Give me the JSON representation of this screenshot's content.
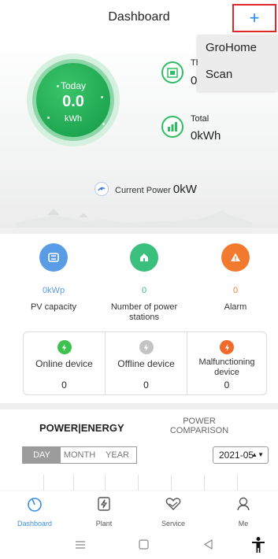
{
  "header": {
    "title": "Dashboard",
    "add_label": "+"
  },
  "dropdown_menu": {
    "items": [
      "GroHome",
      "Scan"
    ]
  },
  "energy": {
    "today_label": "Today",
    "today_value": "0.0",
    "today_unit": "kWh",
    "this_label_partial": "Th",
    "this_value_partial": "0",
    "total_label": "Total",
    "total_value": "0kWh",
    "current_power_label": "Current Power",
    "current_power_value": "0kW"
  },
  "metrics": [
    {
      "value": "0kWp",
      "label": "PV capacity",
      "color": "#5a9be6",
      "icon": "pv-panel-icon"
    },
    {
      "value": "0",
      "label": "Number of power stations",
      "color": "#3bbf7c",
      "icon": "home-icon"
    },
    {
      "value": "0",
      "label": "Alarm",
      "color": "#f27a2f",
      "icon": "warning-icon"
    }
  ],
  "devices": [
    {
      "label": "Online device",
      "value": "0",
      "color": "#3ec24f",
      "icon": "bolt-icon"
    },
    {
      "label": "Offline device",
      "value": "0",
      "color": "#c4c4c4",
      "icon": "bolt-icon"
    },
    {
      "label": "Malfunctioning device",
      "value": "0",
      "color": "#f06a2b",
      "icon": "bolt-icon"
    }
  ],
  "tabs": {
    "active": "POWER|ENERGY",
    "inactive": "POWER COMPARISON"
  },
  "period": {
    "options": [
      "DAY",
      "MONTH",
      "YEAR"
    ],
    "selected": "DAY",
    "date": "2021-05"
  },
  "nav": [
    {
      "label": "Dashboard",
      "active": true,
      "icon": "dashboard-icon"
    },
    {
      "label": "Plant",
      "active": false,
      "icon": "plant-icon"
    },
    {
      "label": "Service",
      "active": false,
      "icon": "service-icon"
    },
    {
      "label": "Me",
      "active": false,
      "icon": "me-icon"
    }
  ],
  "colors": {
    "accent": "#1f8cf0",
    "green": "#2fbd63",
    "nav_active": "#3a8de0"
  }
}
